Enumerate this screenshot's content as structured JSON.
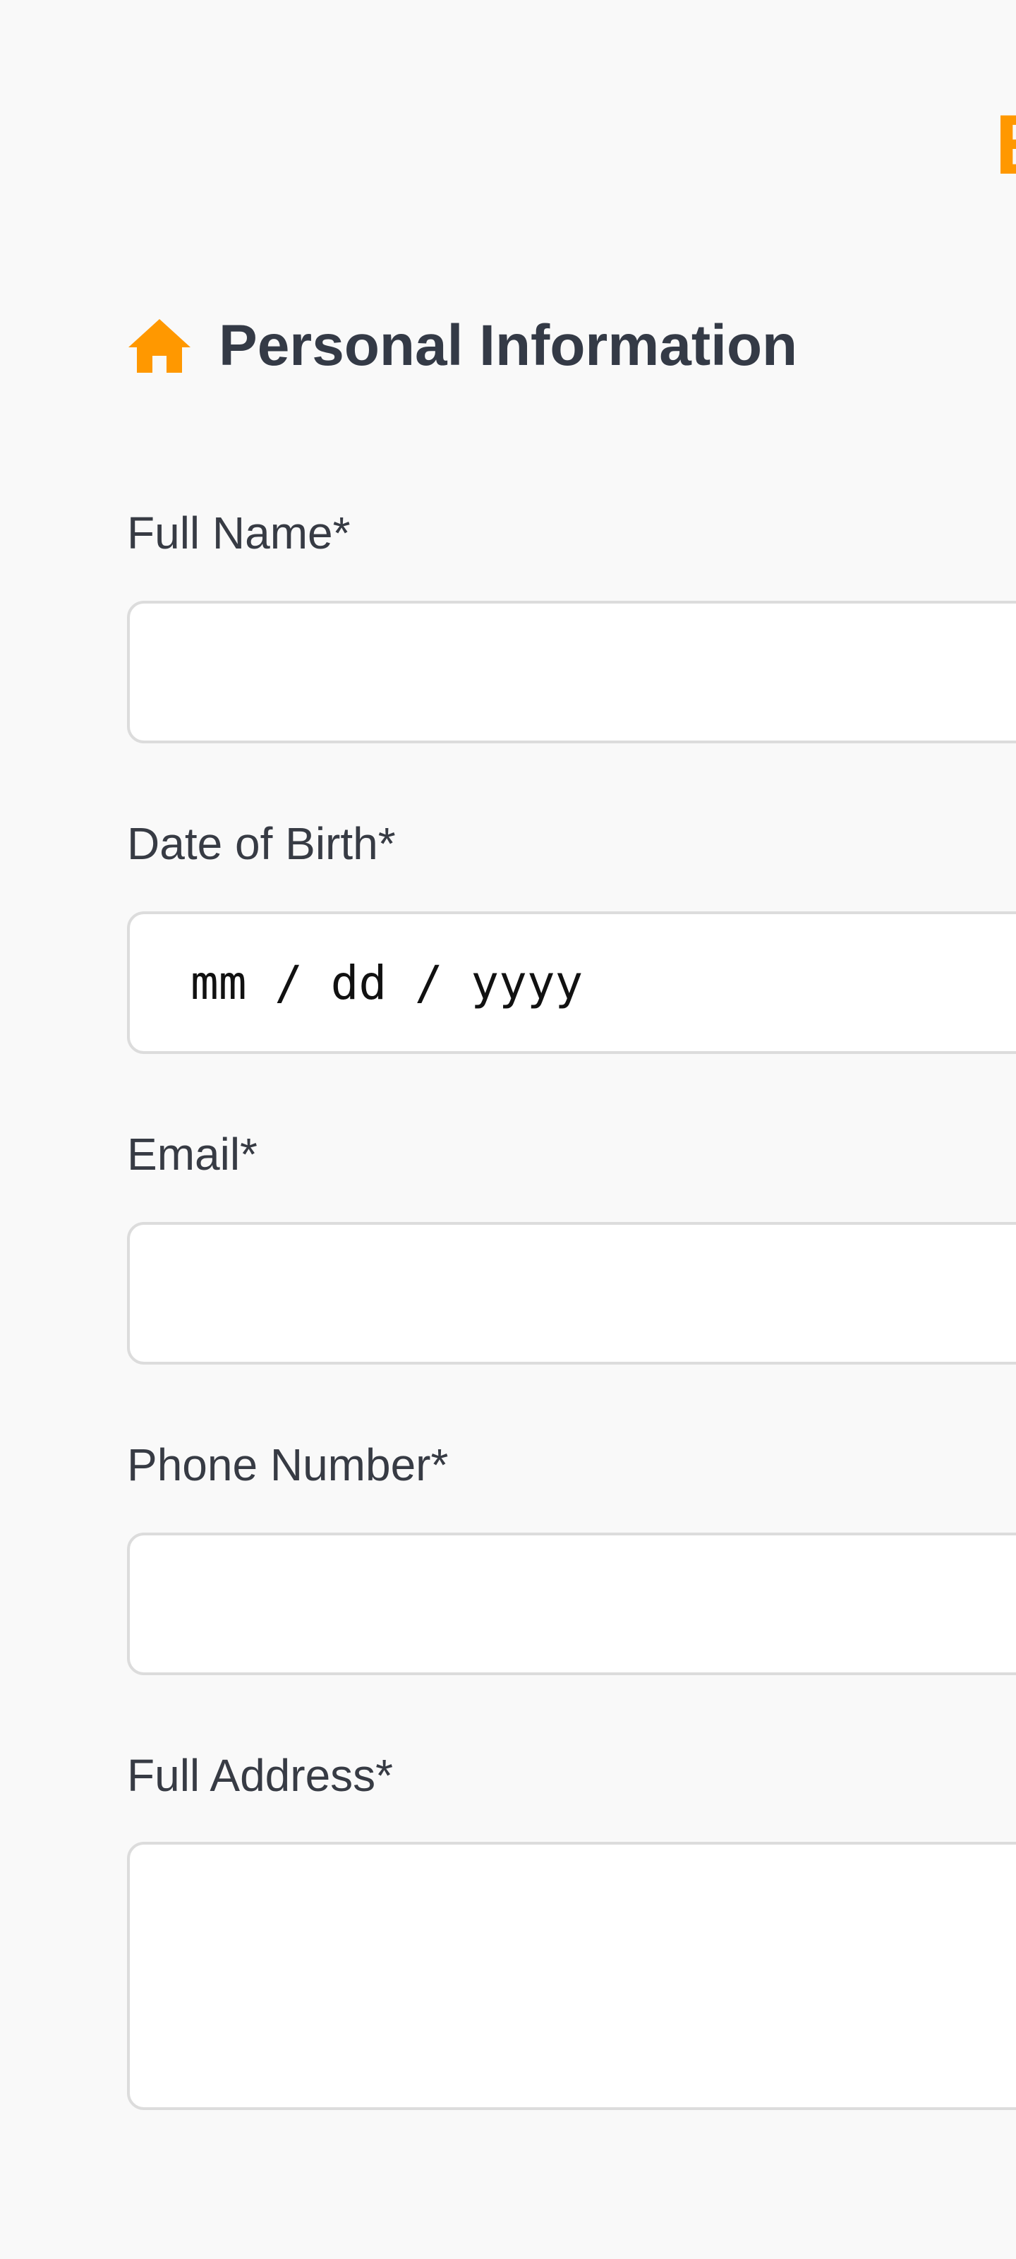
{
  "header": {
    "brand_fragment": "E"
  },
  "section": {
    "icon": "home-icon",
    "title": "Personal Information"
  },
  "fields": {
    "full_name": {
      "label": "Full Name*",
      "value": ""
    },
    "date_of_birth": {
      "label": "Date of Birth*",
      "placeholder": "mm / dd / yyyy",
      "value": ""
    },
    "email": {
      "label": "Email*",
      "value": ""
    },
    "phone": {
      "label": "Phone Number*",
      "value": ""
    },
    "address": {
      "label": "Full Address*",
      "value": ""
    }
  },
  "colors": {
    "accent": "#ff9800",
    "heading": "#343a46",
    "label": "#373b44",
    "input_border": "#dcdcdc",
    "background": "#f9f9f9"
  }
}
